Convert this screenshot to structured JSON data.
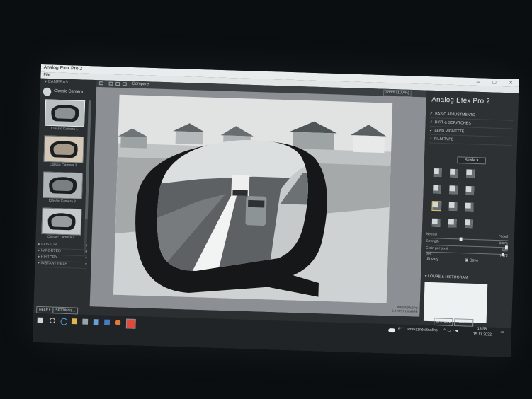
{
  "window": {
    "title": "Analog Efex Pro 2",
    "menu_file": "File"
  },
  "left_panel": {
    "section_title": "CAMERAS",
    "preset_group": "Classic Camera",
    "presets": [
      {
        "label": "Classic Camera 1"
      },
      {
        "label": "Classic Camera 2"
      },
      {
        "label": "Classic Camera 3"
      },
      {
        "label": "Classic Camera 4"
      }
    ],
    "categories": [
      "CUSTOM",
      "IMPORTED",
      "HISTORY",
      "INSTANT HELP"
    ],
    "help_button": "HELP ▾",
    "settings_button": "SETTINGS..."
  },
  "toolbar": {
    "compare": "Compare",
    "zoom": "Zoom (100 %)"
  },
  "canvas": {
    "image_name": "PREVIEW.JPG",
    "image_info": "3.4 MP, 5 bit sRGB"
  },
  "right_panel": {
    "brand": "Analog Efex Pro",
    "brand_version": "2",
    "sections": [
      {
        "label": "BASIC ADJUSTMENTS"
      },
      {
        "label": "DIRT & SCRATCHES"
      },
      {
        "label": "LENS VIGNETTE"
      },
      {
        "label": "FILM TYPE"
      }
    ],
    "film_dropdown": "Subtle",
    "sliders": [
      {
        "left": "Neutral",
        "right": "Faded",
        "value": 0.42
      },
      {
        "left": "Strength",
        "right": "100%",
        "value": 1.0
      },
      {
        "left": "Grain per pixel",
        "right": "500",
        "value": 0.96
      },
      {
        "left": "Soft",
        "right": "Hard",
        "value": 0.5
      }
    ],
    "dice_label": "Vary",
    "save_label": "Save",
    "loupe_label": "LOUPE & HISTOGRAM"
  },
  "buttons": {
    "cancel": "CANCEL",
    "save": "SAVE"
  },
  "taskbar": {
    "weather": "9°C",
    "weather_desc": "Převážně oblačno",
    "time": "13:58",
    "date": "15.11.2022"
  }
}
